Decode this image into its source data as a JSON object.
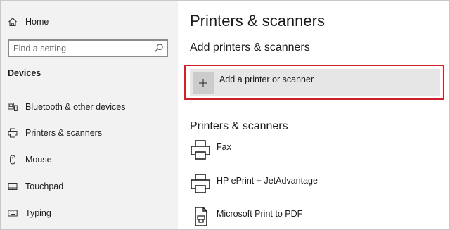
{
  "sidebar": {
    "home_label": "Home",
    "search": {
      "placeholder": "Find a setting"
    },
    "section_title": "Devices",
    "items": [
      {
        "label": "Bluetooth & other devices",
        "icon": "bluetooth-devices-icon"
      },
      {
        "label": "Printers & scanners",
        "icon": "printer-icon"
      },
      {
        "label": "Mouse",
        "icon": "mouse-icon"
      },
      {
        "label": "Touchpad",
        "icon": "touchpad-icon"
      },
      {
        "label": "Typing",
        "icon": "keyboard-icon"
      }
    ]
  },
  "main": {
    "title": "Printers & scanners",
    "add_section_title": "Add printers & scanners",
    "add_button_label": "Add a printer or scanner",
    "list_section_title": "Printers & scanners",
    "printers": [
      {
        "name": "Fax",
        "icon": "fax-printer-icon"
      },
      {
        "name": "HP ePrint + JetAdvantage",
        "icon": "printer-icon"
      },
      {
        "name": "Microsoft Print to PDF",
        "icon": "pdf-printer-icon"
      }
    ]
  },
  "colors": {
    "sidebar_bg": "#f2f2f2",
    "highlight_border": "#d0212a",
    "add_button_bg": "#e6e6e6",
    "plus_tile_bg": "#cccccc"
  }
}
